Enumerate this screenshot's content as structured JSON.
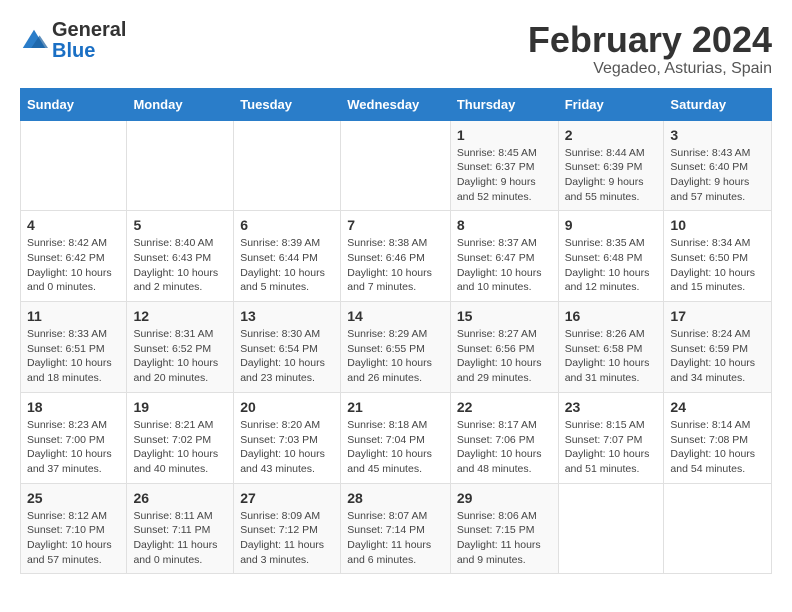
{
  "header": {
    "logo_general": "General",
    "logo_blue": "Blue",
    "month_title": "February 2024",
    "location": "Vegadeo, Asturias, Spain"
  },
  "days_of_week": [
    "Sunday",
    "Monday",
    "Tuesday",
    "Wednesday",
    "Thursday",
    "Friday",
    "Saturday"
  ],
  "weeks": [
    [
      {
        "day": "",
        "info": ""
      },
      {
        "day": "",
        "info": ""
      },
      {
        "day": "",
        "info": ""
      },
      {
        "day": "",
        "info": ""
      },
      {
        "day": "1",
        "info": "Sunrise: 8:45 AM\nSunset: 6:37 PM\nDaylight: 9 hours and 52 minutes."
      },
      {
        "day": "2",
        "info": "Sunrise: 8:44 AM\nSunset: 6:39 PM\nDaylight: 9 hours and 55 minutes."
      },
      {
        "day": "3",
        "info": "Sunrise: 8:43 AM\nSunset: 6:40 PM\nDaylight: 9 hours and 57 minutes."
      }
    ],
    [
      {
        "day": "4",
        "info": "Sunrise: 8:42 AM\nSunset: 6:42 PM\nDaylight: 10 hours and 0 minutes."
      },
      {
        "day": "5",
        "info": "Sunrise: 8:40 AM\nSunset: 6:43 PM\nDaylight: 10 hours and 2 minutes."
      },
      {
        "day": "6",
        "info": "Sunrise: 8:39 AM\nSunset: 6:44 PM\nDaylight: 10 hours and 5 minutes."
      },
      {
        "day": "7",
        "info": "Sunrise: 8:38 AM\nSunset: 6:46 PM\nDaylight: 10 hours and 7 minutes."
      },
      {
        "day": "8",
        "info": "Sunrise: 8:37 AM\nSunset: 6:47 PM\nDaylight: 10 hours and 10 minutes."
      },
      {
        "day": "9",
        "info": "Sunrise: 8:35 AM\nSunset: 6:48 PM\nDaylight: 10 hours and 12 minutes."
      },
      {
        "day": "10",
        "info": "Sunrise: 8:34 AM\nSunset: 6:50 PM\nDaylight: 10 hours and 15 minutes."
      }
    ],
    [
      {
        "day": "11",
        "info": "Sunrise: 8:33 AM\nSunset: 6:51 PM\nDaylight: 10 hours and 18 minutes."
      },
      {
        "day": "12",
        "info": "Sunrise: 8:31 AM\nSunset: 6:52 PM\nDaylight: 10 hours and 20 minutes."
      },
      {
        "day": "13",
        "info": "Sunrise: 8:30 AM\nSunset: 6:54 PM\nDaylight: 10 hours and 23 minutes."
      },
      {
        "day": "14",
        "info": "Sunrise: 8:29 AM\nSunset: 6:55 PM\nDaylight: 10 hours and 26 minutes."
      },
      {
        "day": "15",
        "info": "Sunrise: 8:27 AM\nSunset: 6:56 PM\nDaylight: 10 hours and 29 minutes."
      },
      {
        "day": "16",
        "info": "Sunrise: 8:26 AM\nSunset: 6:58 PM\nDaylight: 10 hours and 31 minutes."
      },
      {
        "day": "17",
        "info": "Sunrise: 8:24 AM\nSunset: 6:59 PM\nDaylight: 10 hours and 34 minutes."
      }
    ],
    [
      {
        "day": "18",
        "info": "Sunrise: 8:23 AM\nSunset: 7:00 PM\nDaylight: 10 hours and 37 minutes."
      },
      {
        "day": "19",
        "info": "Sunrise: 8:21 AM\nSunset: 7:02 PM\nDaylight: 10 hours and 40 minutes."
      },
      {
        "day": "20",
        "info": "Sunrise: 8:20 AM\nSunset: 7:03 PM\nDaylight: 10 hours and 43 minutes."
      },
      {
        "day": "21",
        "info": "Sunrise: 8:18 AM\nSunset: 7:04 PM\nDaylight: 10 hours and 45 minutes."
      },
      {
        "day": "22",
        "info": "Sunrise: 8:17 AM\nSunset: 7:06 PM\nDaylight: 10 hours and 48 minutes."
      },
      {
        "day": "23",
        "info": "Sunrise: 8:15 AM\nSunset: 7:07 PM\nDaylight: 10 hours and 51 minutes."
      },
      {
        "day": "24",
        "info": "Sunrise: 8:14 AM\nSunset: 7:08 PM\nDaylight: 10 hours and 54 minutes."
      }
    ],
    [
      {
        "day": "25",
        "info": "Sunrise: 8:12 AM\nSunset: 7:10 PM\nDaylight: 10 hours and 57 minutes."
      },
      {
        "day": "26",
        "info": "Sunrise: 8:11 AM\nSunset: 7:11 PM\nDaylight: 11 hours and 0 minutes."
      },
      {
        "day": "27",
        "info": "Sunrise: 8:09 AM\nSunset: 7:12 PM\nDaylight: 11 hours and 3 minutes."
      },
      {
        "day": "28",
        "info": "Sunrise: 8:07 AM\nSunset: 7:14 PM\nDaylight: 11 hours and 6 minutes."
      },
      {
        "day": "29",
        "info": "Sunrise: 8:06 AM\nSunset: 7:15 PM\nDaylight: 11 hours and 9 minutes."
      },
      {
        "day": "",
        "info": ""
      },
      {
        "day": "",
        "info": ""
      }
    ]
  ]
}
